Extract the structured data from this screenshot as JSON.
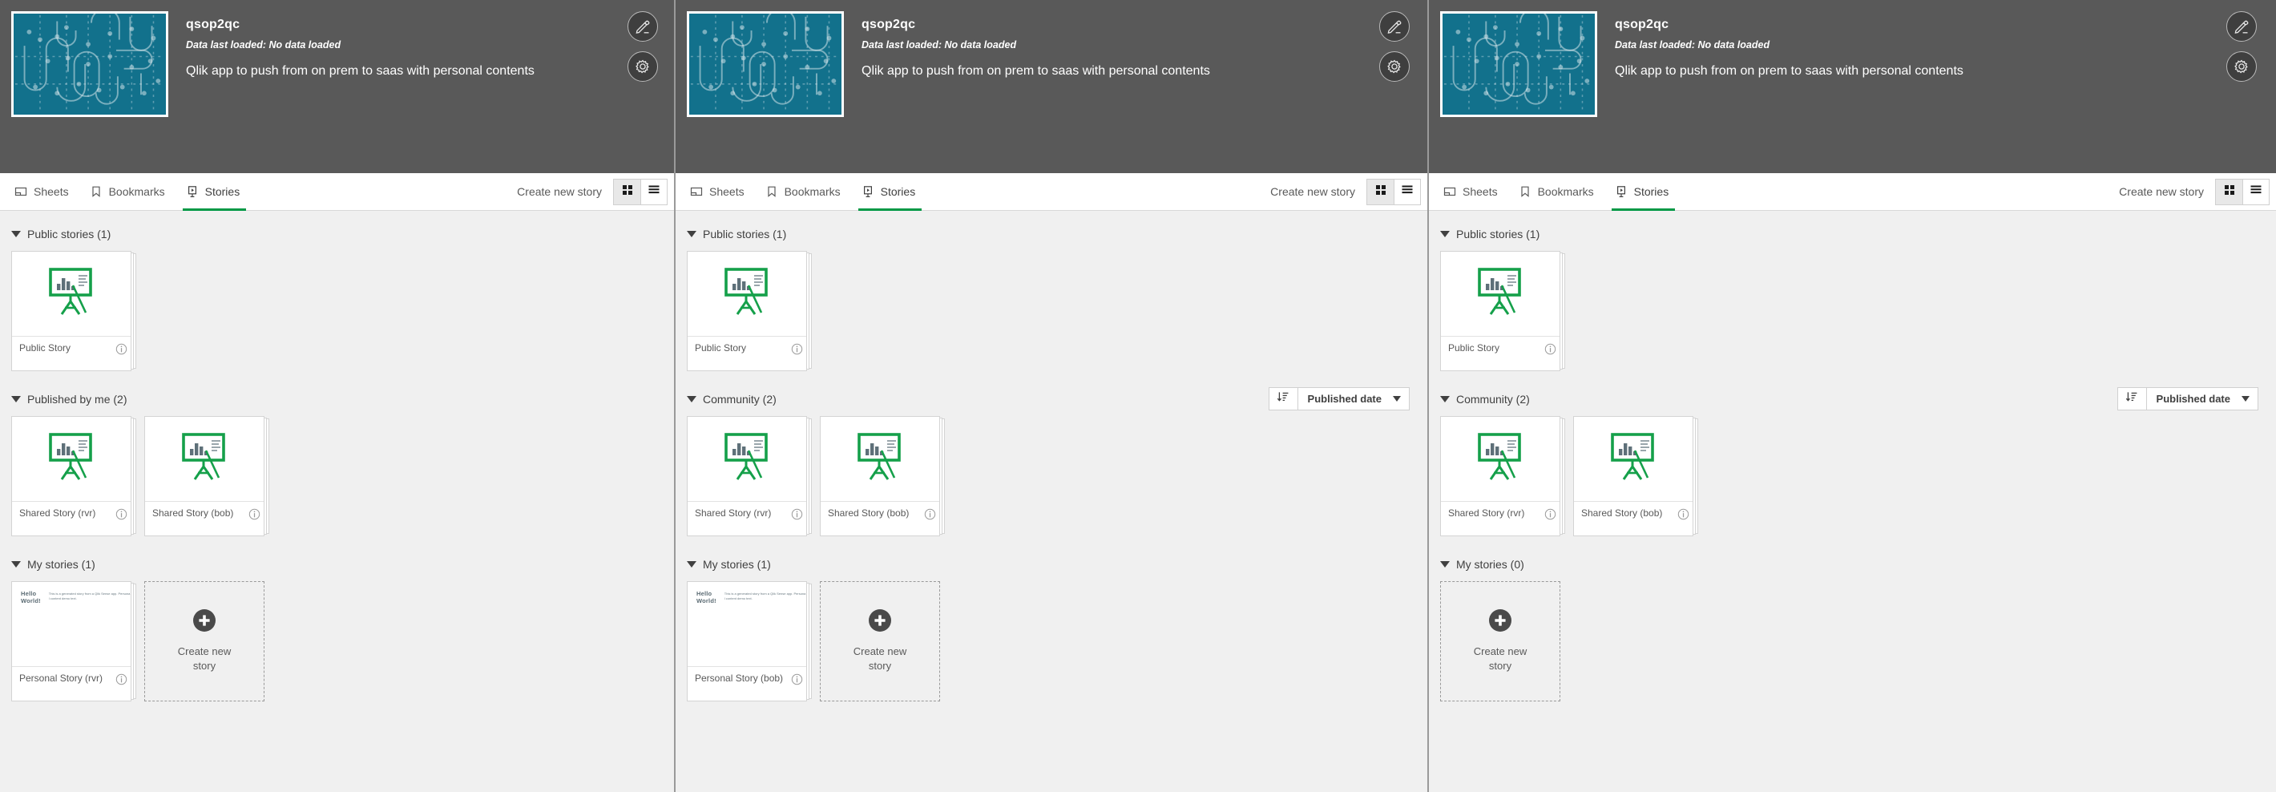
{
  "app": {
    "title": "qsop2qc",
    "data_loaded": "Data last loaded: No data loaded",
    "description": "Qlik app to push from on prem to saas with personal contents",
    "thumbnail_color": "#12718c",
    "edit_button_label": "Edit app",
    "settings_button_label": "App settings",
    "icons": {
      "edit": "pencil-icon",
      "settings": "gear-icon"
    }
  },
  "toolbar": {
    "tabs": [
      {
        "label": "Sheets",
        "icon": "sheet-icon",
        "active": false
      },
      {
        "label": "Bookmarks",
        "icon": "bookmark-icon",
        "active": false
      },
      {
        "label": "Stories",
        "icon": "story-icon",
        "active": true
      }
    ],
    "create_new_story": "Create new story",
    "view_grid": "Grid view",
    "view_list": "List view",
    "active_view": "grid",
    "accent_color": "#009845"
  },
  "sort": {
    "direction_label": "Sort direction",
    "field_label": "Published date"
  },
  "create_card": {
    "line1": "Create new",
    "line2": "story",
    "text": "Create new story"
  },
  "hello_thumb": {
    "title": "Hello World!",
    "body": "This is a generated story from a Qlik Sense app. Personal content demo text."
  },
  "info_label": "Show details",
  "panels": [
    {
      "id": "panel-1",
      "sections": [
        {
          "title": "Public stories (1)",
          "has_sort": false,
          "cards": [
            {
              "name": "Public Story",
              "thumb": "easel"
            }
          ]
        },
        {
          "title": "Published by me (2)",
          "has_sort": false,
          "cards": [
            {
              "name": "Shared Story (rvr)",
              "thumb": "easel"
            },
            {
              "name": "Shared Story (bob)",
              "thumb": "easel"
            }
          ]
        },
        {
          "title": "My stories (1)",
          "has_sort": false,
          "cards": [
            {
              "name": "Personal Story (rvr)",
              "thumb": "hello"
            }
          ],
          "show_create": true
        }
      ]
    },
    {
      "id": "panel-2",
      "sections": [
        {
          "title": "Public stories (1)",
          "has_sort": false,
          "cards": [
            {
              "name": "Public Story",
              "thumb": "easel"
            }
          ]
        },
        {
          "title": "Community (2)",
          "has_sort": true,
          "cards": [
            {
              "name": "Shared Story (rvr)",
              "thumb": "easel"
            },
            {
              "name": "Shared Story (bob)",
              "thumb": "easel"
            }
          ]
        },
        {
          "title": "My stories (1)",
          "has_sort": false,
          "cards": [
            {
              "name": "Personal Story (bob)",
              "thumb": "hello"
            }
          ],
          "show_create": true
        }
      ]
    },
    {
      "id": "panel-3",
      "sections": [
        {
          "title": "Public stories (1)",
          "has_sort": false,
          "cards": [
            {
              "name": "Public Story",
              "thumb": "easel"
            }
          ]
        },
        {
          "title": "Community (2)",
          "has_sort": true,
          "cards": [
            {
              "name": "Shared Story (rvr)",
              "thumb": "easel"
            },
            {
              "name": "Shared Story (bob)",
              "thumb": "easel"
            }
          ]
        },
        {
          "title": "My stories (0)",
          "has_sort": false,
          "cards": [],
          "show_create": true
        }
      ]
    }
  ]
}
